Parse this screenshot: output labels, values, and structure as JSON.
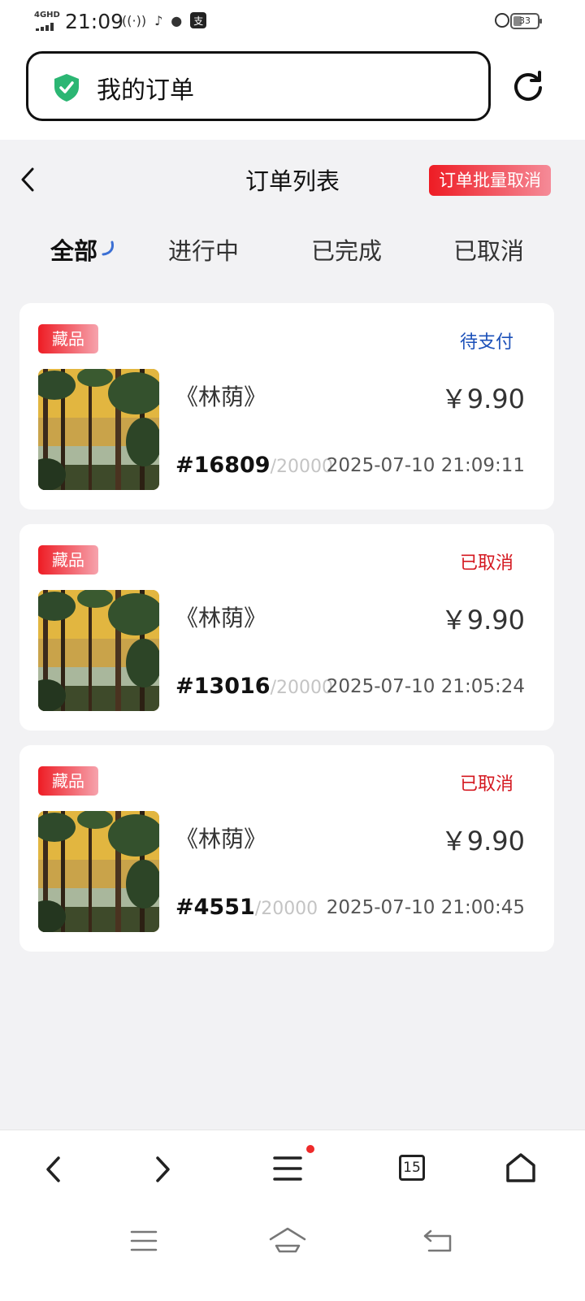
{
  "status_bar": {
    "network": "4GHD",
    "time": "21:09",
    "battery": "33"
  },
  "url_bar": {
    "title": "我的订单"
  },
  "header": {
    "title": "订单列表",
    "batch_cancel_label": "订单批量取消"
  },
  "tabs": [
    {
      "label": "全部",
      "active": true
    },
    {
      "label": "进行中",
      "active": false
    },
    {
      "label": "已完成",
      "active": false
    },
    {
      "label": "已取消",
      "active": false
    }
  ],
  "orders": [
    {
      "badge": "藏品",
      "status": "待支付",
      "name": "《林荫》",
      "price": "￥9.90",
      "serial": "#16809",
      "total": "/20000",
      "timestamp": "2025-07-10 21:09:11"
    },
    {
      "badge": "藏品",
      "status": "已取消",
      "name": "《林荫》",
      "price": "￥9.90",
      "serial": "#13016",
      "total": "/20000",
      "timestamp": "2025-07-10 21:05:24"
    },
    {
      "badge": "藏品",
      "status": "已取消",
      "name": "《林荫》",
      "price": "￥9.90",
      "serial": "#4551",
      "total": "/20000",
      "timestamp": "2025-07-10 21:00:45"
    }
  ],
  "bottom_nav": {
    "tab_count": "15"
  },
  "colors": {
    "accent_red": "#ee1c24",
    "pending_blue": "#1b50b9",
    "cancelled_red": "#d41820",
    "shield_green": "#2bb673"
  }
}
